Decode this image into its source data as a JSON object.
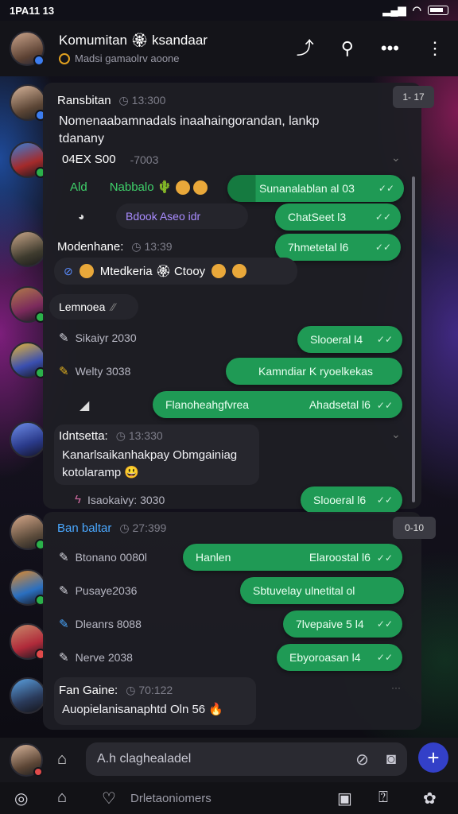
{
  "status": {
    "time": "1PA11 13"
  },
  "header": {
    "title": "Komumitan 🏵 ksandaar",
    "subtitle": "Madsi gamaolrv aoone",
    "icons": [
      "share-icon",
      "search-icon",
      "more-horizontal-icon",
      "more-vertical-icon"
    ]
  },
  "messages": {
    "m1": {
      "name": "Ransbitan",
      "time": "◷ 13:300",
      "badge": "1- 17",
      "text": "Nomenaabamnadals inaahaingorandan, lankp tdanany",
      "price": "04EX S00",
      "price_time": "-7003"
    },
    "row_ald": {
      "left": "Ald",
      "mid": "Nabbalo 🌵",
      "pill": "Sunanalablan al 03"
    },
    "row_bdook": {
      "dark": "Bdook Aseo idr",
      "pill": "ChatSeet l3"
    },
    "m2": {
      "name": "Modenhane:",
      "time": "◷ 13:39",
      "pill": "7hmetetal l6",
      "reactions": "Mtedkeria 🏵 Ctooy"
    },
    "kemnoe": {
      "label": "Lemnoea"
    },
    "r1": {
      "label": "Sikaiyr 2030",
      "pill": "Slooeral l4"
    },
    "r2": {
      "label": "Welty 3038",
      "pill": "Kamndiar K ryoelkekas"
    },
    "r3": {
      "pill_left": "Flanoheahgfvrea",
      "pill_right": "Ahadsetal l6"
    },
    "m3": {
      "name": "Idntsetta:",
      "time": "◷ 13:330",
      "text": "Kanarlsaikanhakpay Obmgainiag kotolaramp 😃"
    },
    "r4": {
      "label": "Isaokaivy: 3030",
      "pill": "Slooeral l6"
    },
    "m4": {
      "name": "Ban baltar",
      "time": "◷ 27:399",
      "badge": "0-10"
    },
    "r5": {
      "label": "Btonano 0080l",
      "pill_left": "Hanlen",
      "pill_right": "Elaroostal l6"
    },
    "r6": {
      "label": "Pusaye2036",
      "pill": "Sbtuvelay ulnetital ol"
    },
    "r7": {
      "label": "Dleanrs 8088",
      "pill": "7lvepaive 5 l4"
    },
    "r8": {
      "label": "Nerve 2038",
      "pill": "Ebyoroasan l4"
    },
    "m5": {
      "name": "Fan Gaine:",
      "time": "◷ 70:122",
      "text": "Auopielanisanaphtd Oln 56 🔥"
    }
  },
  "composer": {
    "placeholder": "A.h claghealadel"
  },
  "navbar": {
    "label": "Drletaoniomers"
  },
  "colors": {
    "accent_green": "#1f9a55",
    "accent_blue": "#3340c8",
    "panel": "#1e1e24"
  }
}
